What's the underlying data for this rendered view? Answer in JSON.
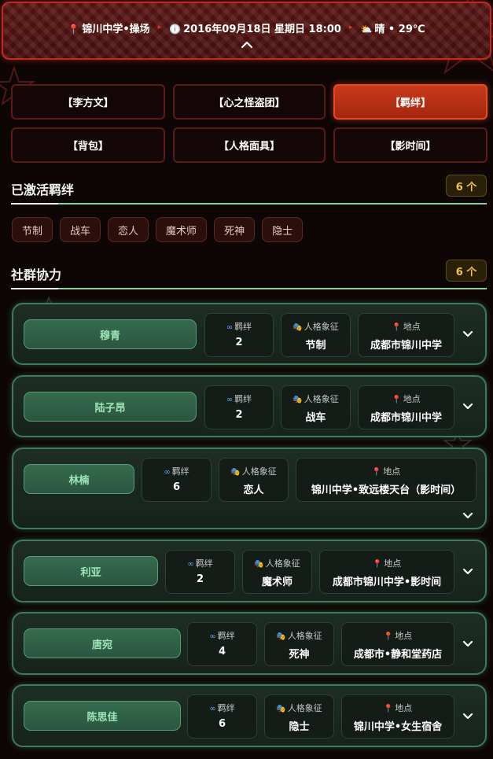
{
  "header": {
    "location": "锦川中学•操场",
    "datetime": "2016年09月18日 星期日 18:00",
    "weather": "晴 • 29℃"
  },
  "tabs": [
    {
      "label": "【李方文】",
      "active": false
    },
    {
      "label": "【心之怪盗团】",
      "active": false
    },
    {
      "label": "【羁绊】",
      "active": true
    },
    {
      "label": "【背包】",
      "active": false
    },
    {
      "label": "【人格面具】",
      "active": false
    },
    {
      "label": "【影时间】",
      "active": false
    }
  ],
  "activated": {
    "title": "已激活羁绊",
    "count": "6 个",
    "chips": [
      "节制",
      "战车",
      "恋人",
      "魔术师",
      "死神",
      "隐士"
    ]
  },
  "social": {
    "title": "社群协力",
    "count": "6 个",
    "labels": {
      "bond": "羁绊",
      "arcana": "人格象征",
      "place": "地点"
    },
    "cards": [
      {
        "name": "穆青",
        "bond": "2",
        "arcana": "节制",
        "place": "成都市锦川中学"
      },
      {
        "name": "陆子昂",
        "bond": "2",
        "arcana": "战车",
        "place": "成都市锦川中学"
      },
      {
        "name": "林楠",
        "bond": "6",
        "arcana": "恋人",
        "place": "锦川中学•致远楼天台（影时间）"
      },
      {
        "name": "利亚",
        "bond": "2",
        "arcana": "魔术师",
        "place": "成都市锦川中学•影时间"
      },
      {
        "name": "唐宛",
        "bond": "4",
        "arcana": "死神",
        "place": "成都市•静和堂药店"
      },
      {
        "name": "陈思佳",
        "bond": "6",
        "arcana": "隐士",
        "place": "锦川中学•女生宿舍"
      }
    ]
  },
  "colors": {
    "accent": "#c93a1c",
    "bond_green": "#3f7a5a",
    "count_gold": "#f2c44a"
  }
}
